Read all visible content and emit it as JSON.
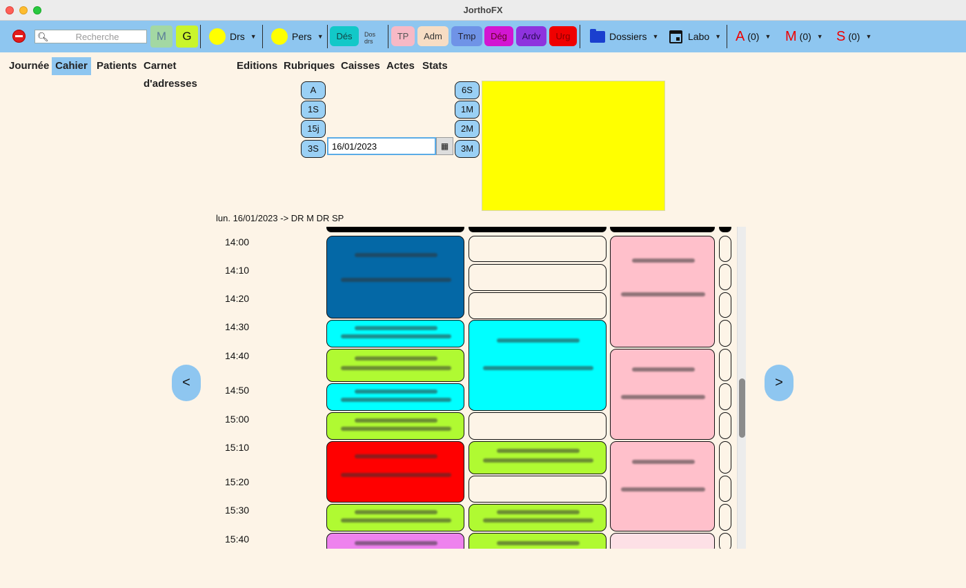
{
  "window": {
    "title": "JorthoFX"
  },
  "toolbar": {
    "search_placeholder": "Recherche",
    "btn_m": "M",
    "btn_g": "G",
    "drs_label": "Drs",
    "pers_label": "Pers",
    "des_label": "Dés",
    "dosdrs_label": "Dos drs",
    "tags": {
      "tp": "TP",
      "adm": "Adm",
      "tmp": "Tmp",
      "deg": "Dég",
      "ardv": "Ardv",
      "urg": "Urg"
    },
    "dossiers_label": "Dossiers",
    "labo_label": "Labo",
    "counters": [
      {
        "letter": "A",
        "count": "(0)"
      },
      {
        "letter": "M",
        "count": "(0)"
      },
      {
        "letter": "S",
        "count": "(0)"
      }
    ]
  },
  "menu": [
    {
      "label": "Journée",
      "active": false
    },
    {
      "label": "Cahier",
      "active": true
    },
    {
      "label": "Patients",
      "active": false
    },
    {
      "label": "Carnet d'adresses",
      "active": false
    },
    {
      "label": "Editions",
      "active": false
    },
    {
      "label": "Rubriques",
      "active": false
    },
    {
      "label": "Caisses",
      "active": false
    },
    {
      "label": "Actes",
      "active": false
    },
    {
      "label": "Stats",
      "active": false
    }
  ],
  "range_buttons_left": [
    "A",
    "1S",
    "15j",
    "3S"
  ],
  "range_buttons_right": [
    "6S",
    "1M",
    "2M",
    "3M"
  ],
  "date_value": "16/01/2023",
  "day_header": "lun. 16/01/2023 -> DR M DR SP",
  "times": [
    "14:00",
    "14:10",
    "14:20",
    "14:30",
    "14:40",
    "14:50",
    "15:00",
    "15:10",
    "15:20",
    "15:30",
    "15:40"
  ],
  "colors": {
    "toolbar": "#8ec6f0",
    "background": "#fdf4e7",
    "dark_blue": "#0468a6",
    "cyan": "#00ffff",
    "green": "#b0fa32",
    "red": "#ff0000",
    "pink": "#ffc0cb",
    "violet": "#ee82ee",
    "empty": "#fdf4e7"
  },
  "nav": {
    "prev": "<",
    "next": ">"
  }
}
